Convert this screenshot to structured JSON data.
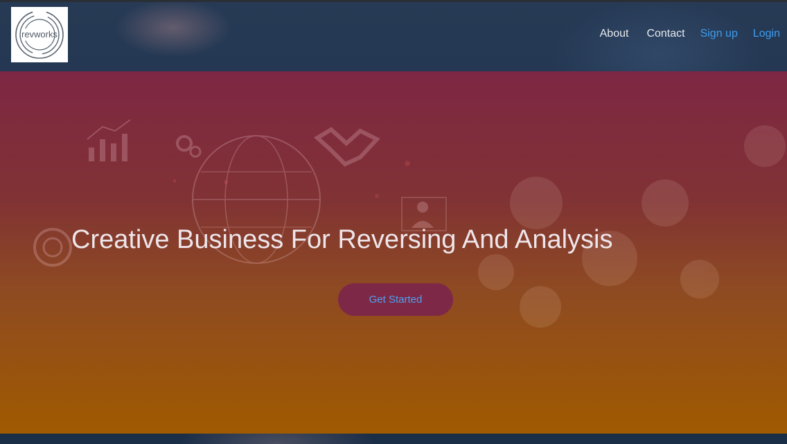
{
  "brand": {
    "logo_text": "revworks"
  },
  "nav": {
    "about": "About",
    "contact": "Contact",
    "signup": "Sign up",
    "login": "Login"
  },
  "hero": {
    "title": "Creative Business For Reversing And Analysis",
    "cta": "Get Started"
  },
  "colors": {
    "link_accent": "#3d9ef0",
    "hero_top": "#7e2744",
    "hero_bottom": "#a05a00",
    "cta_background": "#7e2848"
  },
  "icons": [
    "bar-chart-icon",
    "gear-icon",
    "handshake-icon",
    "globe-icon",
    "person-icon",
    "target-icon"
  ]
}
